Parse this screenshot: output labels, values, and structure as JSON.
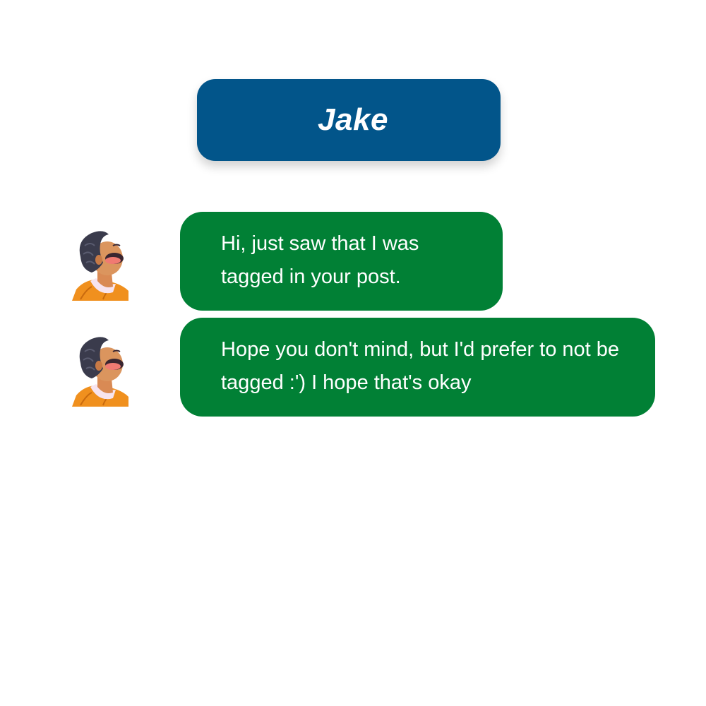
{
  "header": {
    "name": "Jake",
    "color": "#02558A"
  },
  "messages": [
    {
      "text": "Hi, just saw that I was tagged in your post.",
      "avatar": "person-looking-up-avatar",
      "color": "#018035"
    },
    {
      "text": "Hope you don't mind, but I'd prefer to not be tagged :') I hope that's okay",
      "avatar": "person-looking-up-avatar",
      "color": "#018035"
    }
  ]
}
